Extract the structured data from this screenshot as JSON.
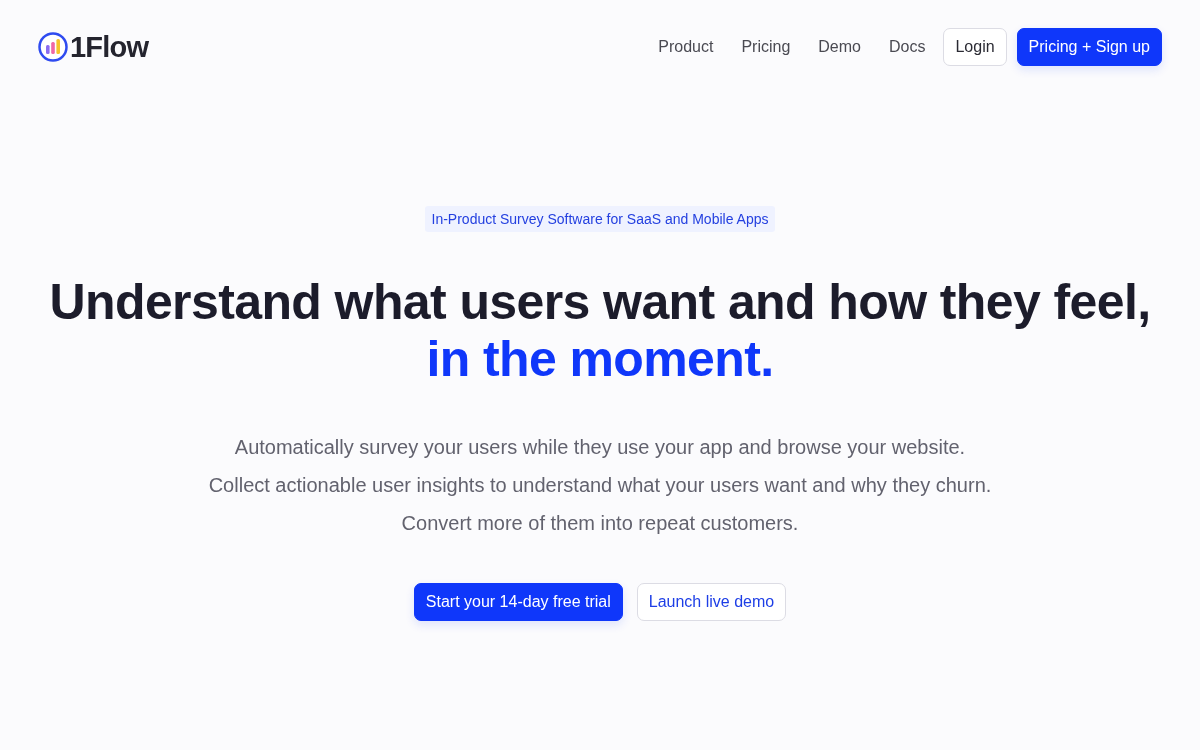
{
  "header": {
    "logo": {
      "text": "1Flow"
    },
    "nav": [
      {
        "label": "Product"
      },
      {
        "label": "Pricing"
      },
      {
        "label": "Demo"
      },
      {
        "label": "Docs"
      }
    ],
    "buttons": [
      {
        "label": "Login",
        "kind": "outline"
      },
      {
        "label": "Pricing + Sign up",
        "kind": "primary"
      }
    ]
  },
  "hero": {
    "badge": "In-Product Survey Software for SaaS and Mobile Apps",
    "headline": {
      "text": "Understand what users want and how they feel,",
      "highlight": "in the moment."
    },
    "description": [
      "Automatically survey your users while they use your app and browse your website.",
      "Collect actionable user insights to understand what your users want and why they churn.",
      "Convert more of them into repeat customers."
    ],
    "buttons": [
      {
        "label": "Start your 14-day free trial",
        "kind": "primary"
      },
      {
        "label": "Launch live demo",
        "kind": "outline"
      }
    ]
  }
}
